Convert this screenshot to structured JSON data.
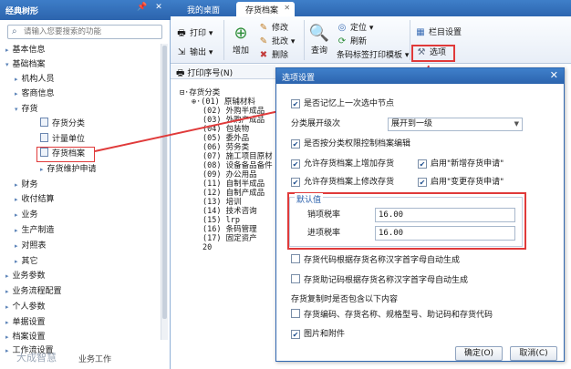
{
  "nav": {
    "title": "经典树形",
    "search_placeholder": "请输入您要搜索的功能",
    "items": [
      {
        "label": "基本信息",
        "arrow": "▸"
      },
      {
        "label": "基础档案",
        "arrow": "▾"
      },
      {
        "label": "机构人员",
        "arrow": "▸"
      },
      {
        "label": "客商信息",
        "arrow": "▸"
      },
      {
        "label": "存货",
        "arrow": "▾"
      },
      {
        "label": "存货分类"
      },
      {
        "label": "计量单位"
      },
      {
        "label": "存货档案"
      },
      {
        "label": "存货维护申请",
        "arrow": "▸"
      },
      {
        "label": "财务",
        "arrow": "▸"
      },
      {
        "label": "收付结算",
        "arrow": "▸"
      },
      {
        "label": "业务",
        "arrow": "▸"
      },
      {
        "label": "生产制造",
        "arrow": "▸"
      },
      {
        "label": "对照表",
        "arrow": "▸"
      },
      {
        "label": "其它",
        "arrow": "▸"
      },
      {
        "label": "业务参数",
        "arrow": "▸"
      },
      {
        "label": "业务流程配置",
        "arrow": "▸"
      },
      {
        "label": "个人参数",
        "arrow": "▸"
      },
      {
        "label": "单据设置",
        "arrow": "▸"
      },
      {
        "label": "档案设置",
        "arrow": "▸"
      },
      {
        "label": "工作流设置",
        "arrow": "▸"
      }
    ],
    "footer": "业务工作"
  },
  "tabs": [
    {
      "label": "我的桌面"
    },
    {
      "label": "存货档案"
    }
  ],
  "toolbar": {
    "print": "打印",
    "output": "输出",
    "add": "增加",
    "modify": "修改",
    "batch": "批改",
    "delete": "删除",
    "query": "查询",
    "locate": "定位",
    "refresh": "刷新",
    "barcode_print": "条码标签打印模板",
    "column_settings": "栏目设置",
    "options": "选项"
  },
  "content": {
    "column_header": "打印序号(N)",
    "tree_root": "存货分类",
    "tree_items": [
      "(01) 原辅材料",
      "(02) 外购半成品",
      "(03) 外购产成品",
      "(04) 包装物",
      "(05) 委外品",
      "(06) 劳务类",
      "(07) 施工项目原材",
      "(08) 设备备品备件",
      "(09) 办公用品",
      "(11) 自制半成品",
      "(12) 自制产成品",
      "(13) 培训",
      "(14) 技术咨询",
      "(15) lrp",
      "(16) 条码管理",
      "(17) 固定资产",
      "20"
    ]
  },
  "dialog": {
    "title": "选项设置",
    "remember_node": "是否记忆上一次选中节点",
    "expand_level_label": "分类展开级次",
    "expand_level_value": "展开到一级",
    "permission_control": "是否按分类权限控制档案编辑",
    "allow_add": "允许存货档案上增加存货",
    "enable_new_apply": "启用\"新增存货申请\"",
    "allow_modify": "允许存货档案上修改存货",
    "enable_change_apply": "启用\"变更存货申请\"",
    "defaults_title": "默认值",
    "sales_tax_label": "销项税率",
    "sales_tax_value": "16.00",
    "purchase_tax_label": "进项税率",
    "purchase_tax_value": "16.00",
    "auto_code": "存货代码根据存货名称汉字首字母自动生成",
    "auto_mnemonic": "存货助记码根据存货名称汉字首字母自动生成",
    "copy_section_title": "存货复制时是否包含以下内容",
    "copy_basic": "存货编码、存货名称、规格型号、助记码和存货代码",
    "copy_images": "图片和附件",
    "ok": "确定(O)",
    "cancel": "取消(C)"
  },
  "watermark": "大成智慧",
  "colors": {
    "title_bar": "#2f6cb8",
    "highlight": "#e03a3a"
  }
}
